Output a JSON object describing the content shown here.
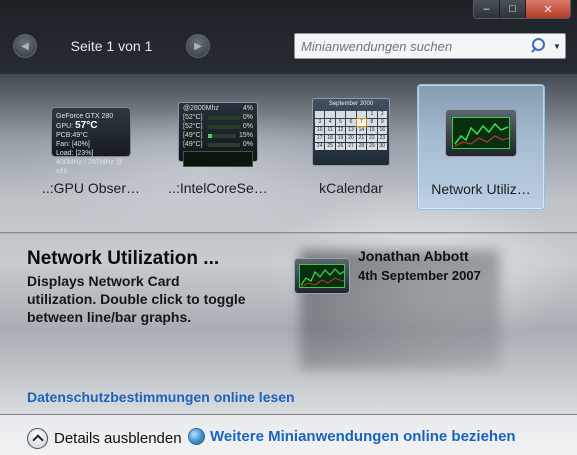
{
  "window": {
    "controls": {
      "minimize": "–",
      "maximize": "□",
      "close": "✕"
    }
  },
  "pager": {
    "label": "Seite 1 von 1",
    "prev_icon": "chevron-left",
    "next_icon": "chevron-right"
  },
  "search": {
    "placeholder": "Minianwendungen suchen"
  },
  "gadgets": [
    {
      "label": "..:GPU Obser…",
      "thumb": {
        "model": "GeForce GTX 280",
        "gpu_label": "GPU:",
        "gpu_temp": "57°C",
        "pcb_label": "PCB:",
        "pcb_temp": "49°C",
        "fan": "Fan: [40%]",
        "load": "Load: [23%]",
        "clock": "400MHz / 297MHz @ x16"
      }
    },
    {
      "label": "..:IntelCoreSe…",
      "thumb": {
        "freq": "@2800Mhz",
        "usage": "4%",
        "rows": [
          "[52°C]",
          "[52°C]",
          "[49°C]",
          "[49°C]"
        ],
        "row_values": [
          "0%",
          "0%",
          "15%",
          "0%"
        ],
        "row_levels": [
          0.0,
          0.0,
          0.15,
          0.0
        ]
      }
    },
    {
      "label": "kCalendar",
      "thumb": {
        "month": "September 2000",
        "days": [
          "",
          "",
          "",
          "",
          "",
          "1",
          "2",
          "3",
          "4",
          "5",
          "6",
          "7",
          "8",
          "9",
          "10",
          "11",
          "12",
          "13",
          "14",
          "15",
          "16",
          "17",
          "18",
          "19",
          "20",
          "21",
          "22",
          "23",
          "24",
          "25",
          "26",
          "27",
          "28",
          "29",
          "30"
        ],
        "today": "7"
      }
    },
    {
      "label": "Network Utiliz…",
      "selected": true
    }
  ],
  "details": {
    "title": "Network Utilization ...",
    "description": "Displays Network Card utilization.  Double click to toggle between line/bar graphs.",
    "author": "Jonathan Abbott",
    "date": "4th September 2007"
  },
  "links": {
    "privacy": "Datenschutzbestimmungen online lesen",
    "more": "Weitere Minianwendungen online beziehen"
  },
  "footer": {
    "toggle_details": "Details ausblenden"
  },
  "colors": {
    "link": "#1b63bf",
    "selection": "#b2d6f6",
    "graph": "#34d04c"
  }
}
